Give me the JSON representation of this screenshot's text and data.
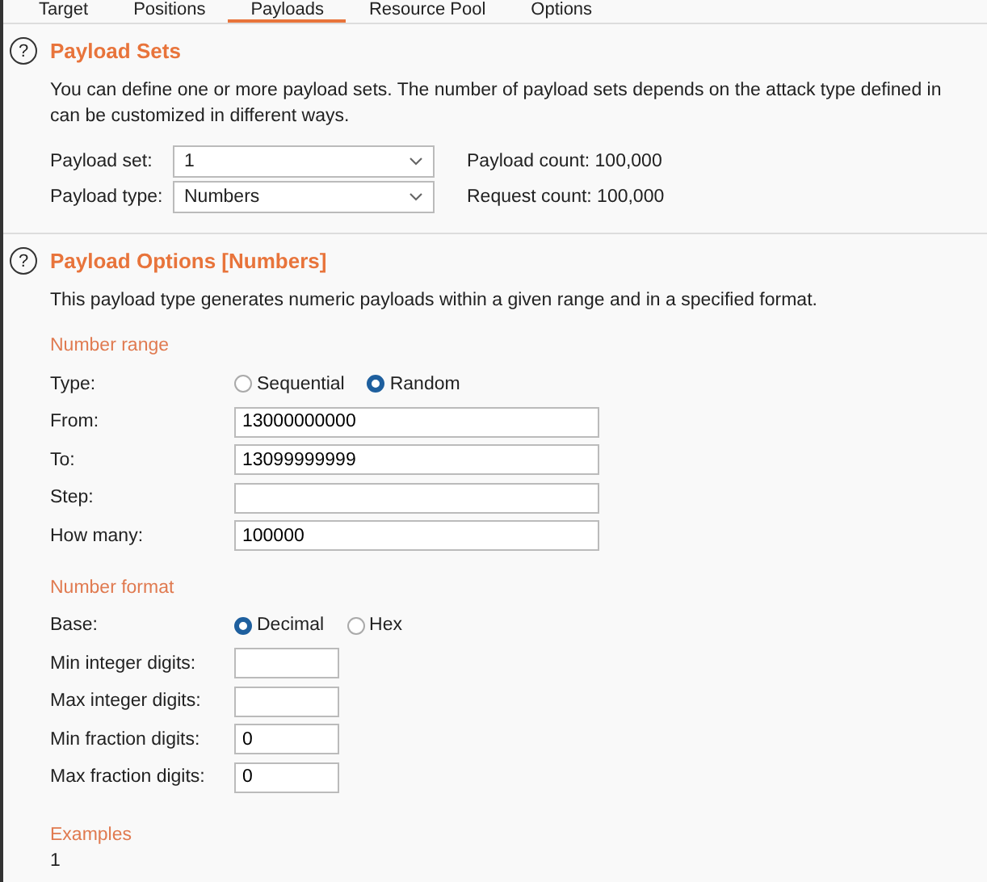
{
  "tabs": [
    {
      "label": "Target",
      "selected": false
    },
    {
      "label": "Positions",
      "selected": false
    },
    {
      "label": "Payloads",
      "selected": true
    },
    {
      "label": "Resource Pool",
      "selected": false
    },
    {
      "label": "Options",
      "selected": false
    }
  ],
  "payload_sets": {
    "help": "?",
    "title": "Payload Sets",
    "description": [
      "You can define one or more payload sets. The number of payload sets depends on the attack type defined in",
      "can be customized in different ways."
    ],
    "rows": [
      {
        "label": "Payload set:",
        "value": "1",
        "count": "Payload count: 100,000"
      },
      {
        "label": "Payload type:",
        "value": "Numbers",
        "count": "Request count: 100,000"
      }
    ]
  },
  "payload_options": {
    "help": "?",
    "title": "Payload Options [Numbers]",
    "description": "This payload type generates numeric payloads within a given range and in a specified format.",
    "sections": [
      {
        "heading": "Number range",
        "rows": [
          {
            "kind": "radio",
            "label": "Type:",
            "options": [
              {
                "label": "Sequential",
                "selected": false
              },
              {
                "label": "Random",
                "selected": true
              }
            ]
          },
          {
            "kind": "wide_field",
            "label": "From:",
            "value": "13000000000"
          },
          {
            "kind": "wide_field",
            "label": "To:",
            "value": "13099999999"
          },
          {
            "kind": "wide_field",
            "label": "Step:"
          },
          {
            "kind": "wide_field",
            "label": "How many:",
            "value": "100000"
          }
        ]
      },
      {
        "heading": "Number format",
        "rows": [
          {
            "kind": "radio",
            "label": "Base:",
            "options": [
              {
                "label": "Decimal",
                "selected": true
              },
              {
                "label": "Hex",
                "selected": false
              }
            ]
          },
          {
            "kind": "short_field",
            "label": "Min integer digits:"
          },
          {
            "kind": "short_field",
            "label": "Max integer digits:"
          },
          {
            "kind": "short_field",
            "label": "Min fraction digits:",
            "value": "0"
          },
          {
            "kind": "short_field",
            "label": "Max fraction digits:",
            "value": "0"
          }
        ]
      }
    ],
    "examples": {
      "heading": "Examples",
      "items": [
        "1"
      ]
    }
  }
}
